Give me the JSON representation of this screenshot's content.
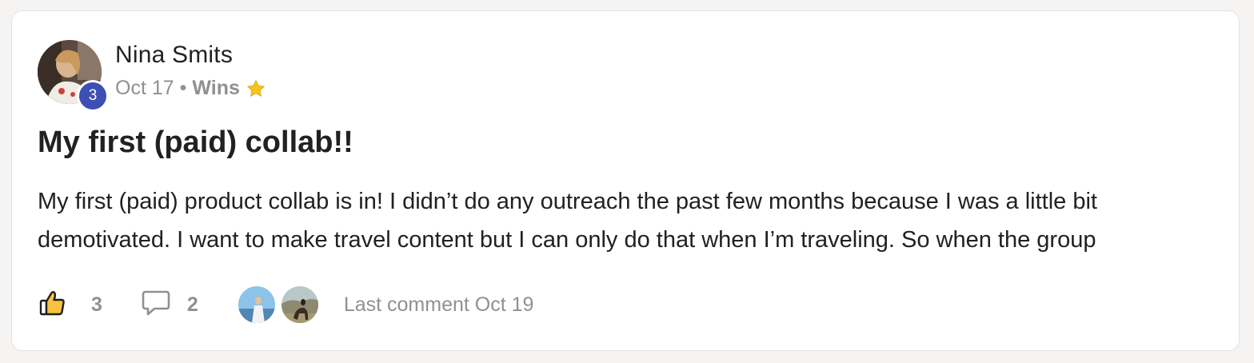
{
  "post": {
    "author": {
      "name": "Nina Smits",
      "level": "3",
      "avatar_icon": "user-avatar-photo"
    },
    "date": "Oct 17",
    "separator": "•",
    "category": "Wins",
    "category_icon": "star-icon",
    "title": "My first (paid) collab!!",
    "body_lines": [
      "My first (paid) product collab is in! I didn’t do any outreach the past few months because I was a little bit",
      "demotivated. I want to make travel content but I can only do that when I’m traveling. So when the group"
    ],
    "likes": "3",
    "comments": "2",
    "last_comment": "Last comment Oct 19"
  },
  "colors": {
    "level_badge": "#3d4fb3",
    "star": "#f5c518",
    "like_icon_fill": "#f7c23f",
    "text_primary": "#202124",
    "text_muted": "#909090"
  }
}
